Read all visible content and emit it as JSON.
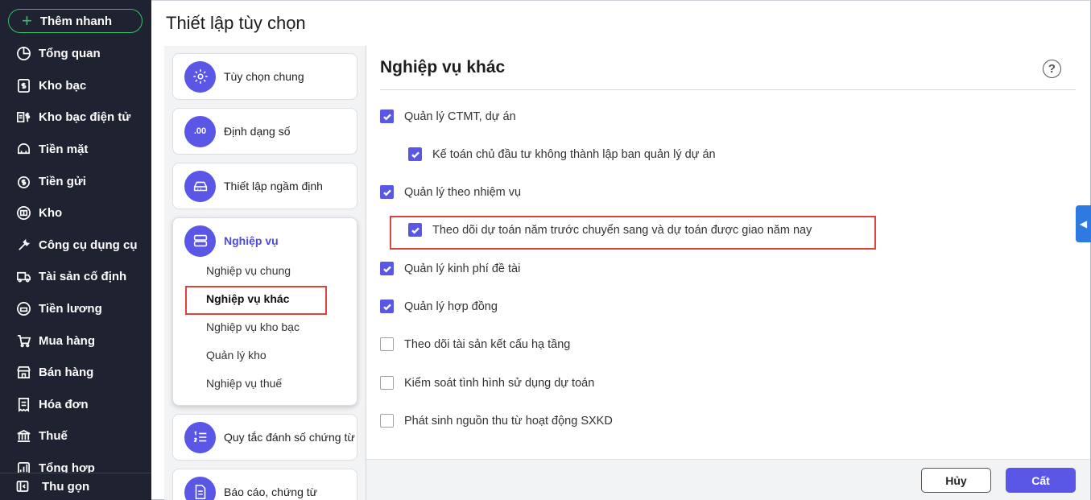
{
  "sidebar": {
    "quick_add": "Thêm nhanh",
    "items": [
      {
        "label": "Tổng quan",
        "icon": "pie-chart-icon"
      },
      {
        "label": "Kho bạc",
        "icon": "dollar-icon"
      },
      {
        "label": "Kho bạc điện tử",
        "icon": "e-treasury-icon"
      },
      {
        "label": "Tiền mặt",
        "icon": "cash-icon"
      },
      {
        "label": "Tiền gửi",
        "icon": "deposit-icon"
      },
      {
        "label": "Kho",
        "icon": "warehouse-icon"
      },
      {
        "label": "Công cụ dụng cụ",
        "icon": "tools-icon"
      },
      {
        "label": "Tài sản cố định",
        "icon": "truck-icon"
      },
      {
        "label": "Tiền lương",
        "icon": "salary-icon"
      },
      {
        "label": "Mua hàng",
        "icon": "cart-icon"
      },
      {
        "label": "Bán hàng",
        "icon": "store-icon"
      },
      {
        "label": "Hóa đơn",
        "icon": "invoice-icon"
      },
      {
        "label": "Thuế",
        "icon": "bank-icon"
      },
      {
        "label": "Tổng hợp",
        "icon": "summary-icon"
      }
    ],
    "collapse": "Thu gọn"
  },
  "page_title": "Thiết lập tùy chọn",
  "menu": {
    "general": "Tùy chọn chung",
    "number_format": "Định dạng số",
    "defaults": "Thiết lập ngầm định",
    "business": "Nghiệp vụ",
    "business_sub": [
      "Nghiệp vụ chung",
      "Nghiệp vụ khác",
      "Nghiệp vụ kho bạc",
      "Quản lý kho",
      "Nghiệp vụ thuế"
    ],
    "numbering": "Quy tắc đánh số chứng từ",
    "reports": "Báo cáo, chứng từ",
    "number_icon_text": ".00"
  },
  "content": {
    "title": "Nghiệp vụ khác",
    "help": "?",
    "options": [
      {
        "label": "Quản lý CTMT, dự án",
        "checked": true
      },
      {
        "label": "Kế toán chủ đầu tư không thành lập ban quản lý dự án",
        "checked": true
      },
      {
        "label": "Quản lý theo nhiệm vụ",
        "checked": true
      },
      {
        "label": "Theo dõi dự toán năm trước chuyển sang và dự toán được giao năm nay",
        "checked": true
      },
      {
        "label": "Quản lý kinh phí đề tài",
        "checked": true
      },
      {
        "label": "Quản lý hợp đồng",
        "checked": true
      },
      {
        "label": "Theo dõi tài sản kết cấu hạ tầng",
        "checked": false
      },
      {
        "label": "Kiểm soát tình hình sử dụng dự toán",
        "checked": false
      },
      {
        "label": "Phát sinh nguồn thu từ hoạt động SXKD",
        "checked": false
      }
    ]
  },
  "footer": {
    "cancel": "Hủy",
    "save": "Cất"
  },
  "colors": {
    "accent": "#5a57e6",
    "sidebar_bg": "#1f2230",
    "highlight": "#e0433f",
    "quick_add_border": "#34c16a"
  }
}
